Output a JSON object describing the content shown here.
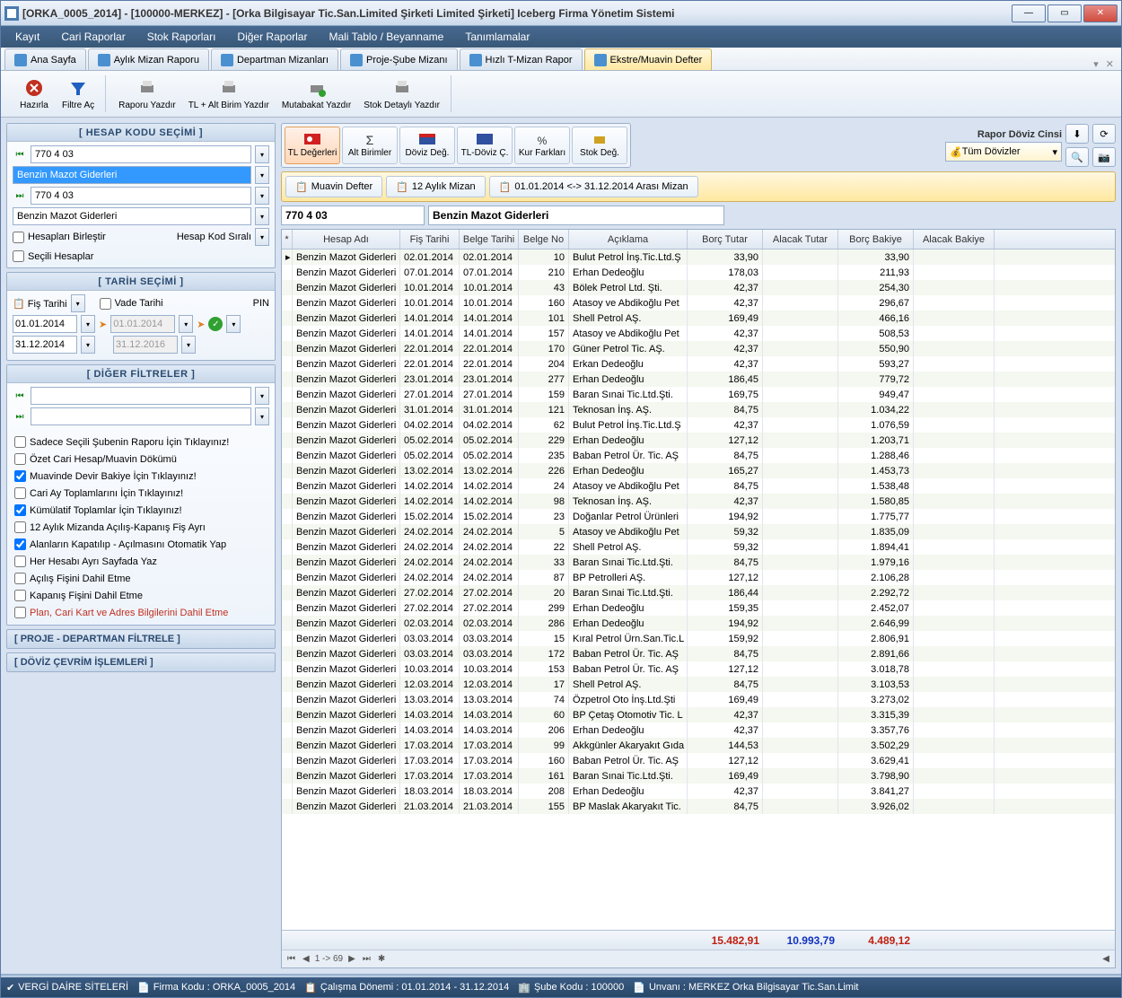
{
  "window": {
    "title": "[ORKA_0005_2014]  -  [100000-MERKEZ]  -  [Orka Bilgisayar Tic.San.Limited Şirketi  Limited Şirketi]     Iceberg Firma Yönetim Sistemi"
  },
  "menu": [
    "Kayıt",
    "Cari Raporlar",
    "Stok Raporları",
    "Diğer Raporlar",
    "Mali Tablo / Beyanname",
    "Tanımlamalar"
  ],
  "tabs": [
    {
      "label": "Ana Sayfa"
    },
    {
      "label": "Aylık Mizan Raporu"
    },
    {
      "label": "Departman Mizanları"
    },
    {
      "label": "Proje-Şube Mizanı"
    },
    {
      "label": "Hızlı T-Mizan Rapor"
    },
    {
      "label": "Ekstre/Muavin Defter",
      "active": true
    }
  ],
  "toolbar": {
    "hazirla": "Hazırla",
    "filtre": "Filtre Aç",
    "raporu": "Raporu Yazdır",
    "tlalt": "TL + Alt Birim Yazdır",
    "mutabakat": "Mutabakat Yazdır",
    "stok": "Stok Detaylı Yazdır"
  },
  "hesap": {
    "hdr": "[  HESAP KODU SEÇİMİ  ]",
    "code1": "770 4 03",
    "name1": "Benzin Mazot Giderleri",
    "code2": "770 4 03",
    "name2": "Benzin Mazot Giderleri",
    "birlestir": "Hesapları Birleştir",
    "sirali": "Hesap Kod Sıralı",
    "secili": "Seçili Hesaplar"
  },
  "tarih": {
    "hdr": "[  TARİH SEÇİMİ  ]",
    "fis": "Fiş Tarihi",
    "vade": "Vade Tarihi",
    "pin": "PIN",
    "d1": "01.01.2014",
    "d2": "31.12.2014",
    "d3": "01.01.2014",
    "d4": "31.12.2016"
  },
  "filtreler": {
    "hdr": "[    DİĞER FİLTRELER    ]",
    "items": [
      {
        "label": "Sadece Seçili Şubenin Raporu İçin Tıklayınız!",
        "chk": false
      },
      {
        "label": "Özet Cari Hesap/Muavin Dökümü",
        "chk": false
      },
      {
        "label": "Muavinde Devir Bakiye İçin Tıklayınız!",
        "chk": true
      },
      {
        "label": "Cari Ay Toplamlarını İçin Tıklayınız!",
        "chk": false
      },
      {
        "label": "Kümülatif Toplamlar İçin Tıklayınız!",
        "chk": true
      },
      {
        "label": "12 Aylık Mizanda Açılış-Kapanış Fiş Ayrı",
        "chk": false
      },
      {
        "label": "Alanların Kapatılıp - Açılmasını  Otomatik Yap",
        "chk": true
      },
      {
        "label": "Her Hesabı Ayrı Sayfada Yaz",
        "chk": false
      },
      {
        "label": "Açılış Fişini Dahil Etme",
        "chk": false
      },
      {
        "label": "Kapanış Fişini Dahil Etme",
        "chk": false
      },
      {
        "label": "Plan, Cari Kart ve Adres Bilgilerini Dahil Etme",
        "chk": false,
        "red": true
      }
    ]
  },
  "collapse": {
    "proje": "[    PROJE - DEPARTMAN FİLTRELE    ]",
    "doviz": "[    DÖVİZ ÇEVRİM İŞLEMLERİ    ]"
  },
  "viewtabs": [
    "TL Değerleri",
    "Alt Birimler",
    "Döviz Değ.",
    "TL-Döviz Ç.",
    "Kur Farkları",
    "Stok Değ."
  ],
  "subtabs": [
    "Muavin Defter",
    "12 Aylık Mizan",
    "01.01.2014 <-> 31.12.2014 Arası Mizan"
  ],
  "rapor": {
    "lbl": "Rapor Döviz Cinsi",
    "val": "Tüm Dövizler"
  },
  "acct": {
    "code": "770 4 03",
    "name": "Benzin Mazot Giderleri"
  },
  "grid": {
    "cols": [
      "Hesap Adı",
      "Fiş Tarihi",
      "Belge Tarihi",
      "Belge No",
      "Açıklama",
      "Borç Tutar",
      "Alacak Tutar",
      "Borç Bakiye",
      "Alacak Bakiye"
    ],
    "rows": [
      [
        "Benzin Mazot Giderleri",
        "02.01.2014",
        "02.01.2014",
        "10",
        "Bulut Petrol İnş.Tic.Ltd.Ş",
        "33,90",
        "",
        "33,90",
        ""
      ],
      [
        "Benzin Mazot Giderleri",
        "07.01.2014",
        "07.01.2014",
        "210",
        "Erhan Dedeoğlu",
        "178,03",
        "",
        "211,93",
        ""
      ],
      [
        "Benzin Mazot Giderleri",
        "10.01.2014",
        "10.01.2014",
        "43",
        "Bölek Petrol Ltd. Şti.",
        "42,37",
        "",
        "254,30",
        ""
      ],
      [
        "Benzin Mazot Giderleri",
        "10.01.2014",
        "10.01.2014",
        "160",
        "Atasoy ve Abdikoğlu Pet",
        "42,37",
        "",
        "296,67",
        ""
      ],
      [
        "Benzin Mazot Giderleri",
        "14.01.2014",
        "14.01.2014",
        "101",
        "Shell Petrol AŞ.",
        "169,49",
        "",
        "466,16",
        ""
      ],
      [
        "Benzin Mazot Giderleri",
        "14.01.2014",
        "14.01.2014",
        "157",
        "Atasoy ve Abdikoğlu Pet",
        "42,37",
        "",
        "508,53",
        ""
      ],
      [
        "Benzin Mazot Giderleri",
        "22.01.2014",
        "22.01.2014",
        "170",
        "Güner Petrol Tic. AŞ.",
        "42,37",
        "",
        "550,90",
        ""
      ],
      [
        "Benzin Mazot Giderleri",
        "22.01.2014",
        "22.01.2014",
        "204",
        "Erkan Dedeoğlu",
        "42,37",
        "",
        "593,27",
        ""
      ],
      [
        "Benzin Mazot Giderleri",
        "23.01.2014",
        "23.01.2014",
        "277",
        "Erhan Dedeoğlu",
        "186,45",
        "",
        "779,72",
        ""
      ],
      [
        "Benzin Mazot Giderleri",
        "27.01.2014",
        "27.01.2014",
        "159",
        "Baran Sınai Tic.Ltd.Şti.",
        "169,75",
        "",
        "949,47",
        ""
      ],
      [
        "Benzin Mazot Giderleri",
        "31.01.2014",
        "31.01.2014",
        "121",
        "Teknosan İnş. AŞ.",
        "84,75",
        "",
        "1.034,22",
        ""
      ],
      [
        "Benzin Mazot Giderleri",
        "04.02.2014",
        "04.02.2014",
        "62",
        "Bulut Petrol İnş.Tic.Ltd.Ş",
        "42,37",
        "",
        "1.076,59",
        ""
      ],
      [
        "Benzin Mazot Giderleri",
        "05.02.2014",
        "05.02.2014",
        "229",
        "Erhan Dedeoğlu",
        "127,12",
        "",
        "1.203,71",
        ""
      ],
      [
        "Benzin Mazot Giderleri",
        "05.02.2014",
        "05.02.2014",
        "235",
        "Baban Petrol Ür. Tic. AŞ",
        "84,75",
        "",
        "1.288,46",
        ""
      ],
      [
        "Benzin Mazot Giderleri",
        "13.02.2014",
        "13.02.2014",
        "226",
        "Erhan Dedeoğlu",
        "165,27",
        "",
        "1.453,73",
        ""
      ],
      [
        "Benzin Mazot Giderleri",
        "14.02.2014",
        "14.02.2014",
        "24",
        "Atasoy ve Abdikoğlu Pet",
        "84,75",
        "",
        "1.538,48",
        ""
      ],
      [
        "Benzin Mazot Giderleri",
        "14.02.2014",
        "14.02.2014",
        "98",
        "Teknosan İnş. AŞ.",
        "42,37",
        "",
        "1.580,85",
        ""
      ],
      [
        "Benzin Mazot Giderleri",
        "15.02.2014",
        "15.02.2014",
        "23",
        "Doğanlar Petrol Ürünleri",
        "194,92",
        "",
        "1.775,77",
        ""
      ],
      [
        "Benzin Mazot Giderleri",
        "24.02.2014",
        "24.02.2014",
        "5",
        "Atasoy ve Abdikoğlu Pet",
        "59,32",
        "",
        "1.835,09",
        ""
      ],
      [
        "Benzin Mazot Giderleri",
        "24.02.2014",
        "24.02.2014",
        "22",
        "Shell Petrol AŞ.",
        "59,32",
        "",
        "1.894,41",
        ""
      ],
      [
        "Benzin Mazot Giderleri",
        "24.02.2014",
        "24.02.2014",
        "33",
        "Baran Sınai Tic.Ltd.Şti.",
        "84,75",
        "",
        "1.979,16",
        ""
      ],
      [
        "Benzin Mazot Giderleri",
        "24.02.2014",
        "24.02.2014",
        "87",
        "BP Petrolleri AŞ.",
        "127,12",
        "",
        "2.106,28",
        ""
      ],
      [
        "Benzin Mazot Giderleri",
        "27.02.2014",
        "27.02.2014",
        "20",
        "Baran Sınai Tic.Ltd.Şti.",
        "186,44",
        "",
        "2.292,72",
        ""
      ],
      [
        "Benzin Mazot Giderleri",
        "27.02.2014",
        "27.02.2014",
        "299",
        "Erhan Dedeoğlu",
        "159,35",
        "",
        "2.452,07",
        ""
      ],
      [
        "Benzin Mazot Giderleri",
        "02.03.2014",
        "02.03.2014",
        "286",
        "Erhan Dedeoğlu",
        "194,92",
        "",
        "2.646,99",
        ""
      ],
      [
        "Benzin Mazot Giderleri",
        "03.03.2014",
        "03.03.2014",
        "15",
        "Kıral Petrol Ürn.San.Tic.L",
        "159,92",
        "",
        "2.806,91",
        ""
      ],
      [
        "Benzin Mazot Giderleri",
        "03.03.2014",
        "03.03.2014",
        "172",
        "Baban Petrol Ür. Tic. AŞ",
        "84,75",
        "",
        "2.891,66",
        ""
      ],
      [
        "Benzin Mazot Giderleri",
        "10.03.2014",
        "10.03.2014",
        "153",
        "Baban Petrol Ür. Tic. AŞ",
        "127,12",
        "",
        "3.018,78",
        ""
      ],
      [
        "Benzin Mazot Giderleri",
        "12.03.2014",
        "12.03.2014",
        "17",
        "Shell Petrol AŞ.",
        "84,75",
        "",
        "3.103,53",
        ""
      ],
      [
        "Benzin Mazot Giderleri",
        "13.03.2014",
        "13.03.2014",
        "74",
        "Özpetrol Oto İnş.Ltd.Şti",
        "169,49",
        "",
        "3.273,02",
        ""
      ],
      [
        "Benzin Mazot Giderleri",
        "14.03.2014",
        "14.03.2014",
        "60",
        "BP Çetaş Otomotiv Tic. L",
        "42,37",
        "",
        "3.315,39",
        ""
      ],
      [
        "Benzin Mazot Giderleri",
        "14.03.2014",
        "14.03.2014",
        "206",
        "Erhan Dedeoğlu",
        "42,37",
        "",
        "3.357,76",
        ""
      ],
      [
        "Benzin Mazot Giderleri",
        "17.03.2014",
        "17.03.2014",
        "99",
        "Akkgünler Akaryakıt Gıda",
        "144,53",
        "",
        "3.502,29",
        ""
      ],
      [
        "Benzin Mazot Giderleri",
        "17.03.2014",
        "17.03.2014",
        "160",
        "Baban Petrol Ür. Tic. AŞ",
        "127,12",
        "",
        "3.629,41",
        ""
      ],
      [
        "Benzin Mazot Giderleri",
        "17.03.2014",
        "17.03.2014",
        "161",
        "Baran Sınai Tic.Ltd.Şti.",
        "169,49",
        "",
        "3.798,90",
        ""
      ],
      [
        "Benzin Mazot Giderleri",
        "18.03.2014",
        "18.03.2014",
        "208",
        "Erhan Dedeoğlu",
        "42,37",
        "",
        "3.841,27",
        ""
      ],
      [
        "Benzin Mazot Giderleri",
        "21.03.2014",
        "21.03.2014",
        "155",
        "BP Maslak Akaryakıt Tic.",
        "84,75",
        "",
        "3.926,02",
        ""
      ]
    ],
    "foot": {
      "borc": "15.482,91",
      "alacak": "10.993,79",
      "borcb": "4.489,12"
    },
    "pager": "1 -> 69"
  },
  "status": {
    "vergi": "VERGİ DAİRE SİTELERİ",
    "firma": "Firma Kodu : ORKA_0005_2014",
    "calisma": "Çalışma Dönemi : 01.01.2014 - 31.12.2014",
    "sube": "Şube Kodu : 100000",
    "unvan": "Unvanı : MERKEZ Orka Bilgisayar Tic.San.Limit"
  }
}
